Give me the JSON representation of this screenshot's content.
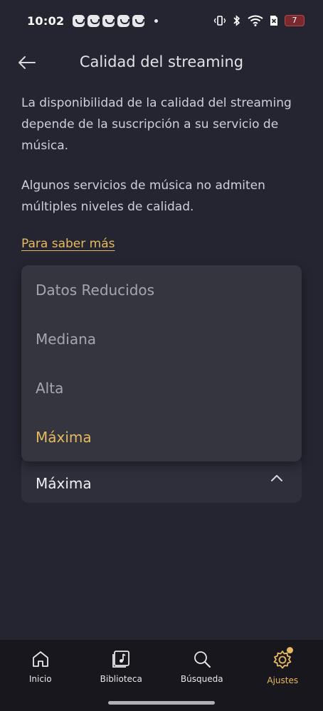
{
  "status_bar": {
    "time": "10:02",
    "battery_level": "7"
  },
  "header": {
    "title": "Calidad del streaming"
  },
  "description": {
    "paragraph1": "La disponibilidad de la calidad del streaming depende de la suscripción a su servicio de música.",
    "paragraph2": "Algunos servicios de música no admiten múltiples niveles de calidad."
  },
  "learn_more": "Para saber más",
  "dropdown": {
    "options": [
      {
        "label": "Datos Reducidos"
      },
      {
        "label": "Mediana"
      },
      {
        "label": "Alta"
      },
      {
        "label": "Máxima"
      }
    ],
    "selected_value": "Máxima"
  },
  "bottom_nav": {
    "items": [
      {
        "label": "Inicio",
        "icon": "home-icon"
      },
      {
        "label": "Biblioteca",
        "icon": "library-icon"
      },
      {
        "label": "Búsqueda",
        "icon": "search-icon"
      },
      {
        "label": "Ajustes",
        "icon": "gear-icon"
      }
    ]
  },
  "colors": {
    "background": "#242530",
    "accent": "#e8b960",
    "nav_background": "#17171d"
  }
}
